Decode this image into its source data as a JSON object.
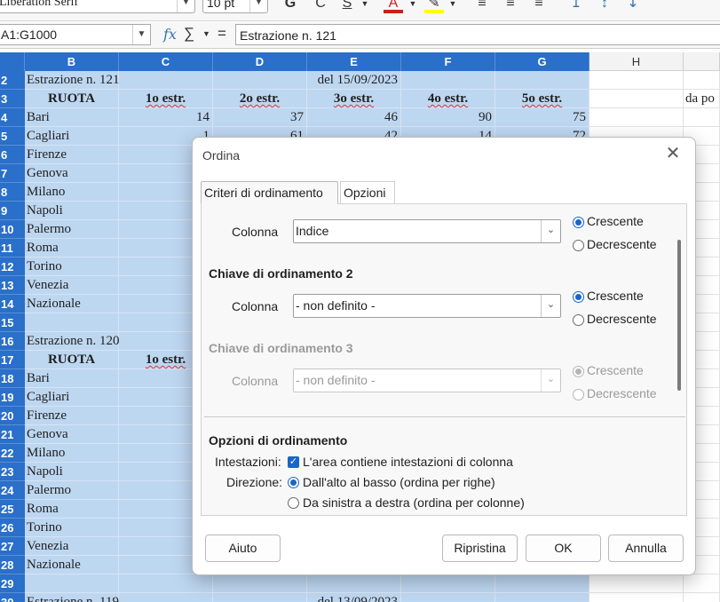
{
  "toolbar": {
    "font_name": "Liberation Serif",
    "font_size": "10 pt",
    "bold": "G",
    "italic": "C",
    "underline": "S",
    "font_color_letter": "A",
    "font_color": "#c9211e",
    "highlight_color": "#ffff00",
    "icons": [
      "bold-icon",
      "italic-icon",
      "underline-icon",
      "font-color-icon",
      "highlight-icon",
      "align-left-icon",
      "align-center-icon",
      "align-right-icon",
      "align-top-icon",
      "align-middle-icon",
      "align-bottom-icon"
    ]
  },
  "formula_bar": {
    "name_box": "A1:G1000",
    "content": "Estrazione n. 121"
  },
  "grid": {
    "columns": [
      "B",
      "C",
      "D",
      "E",
      "F",
      "G",
      "H"
    ],
    "rows": [
      {
        "n": "2",
        "cells": [
          "Estrazione n. 121",
          "",
          "",
          "del 15/09/2023",
          "",
          ""
        ]
      },
      {
        "n": "3",
        "cells": [
          "RUOTA",
          "1o estr.",
          "2o estr.",
          "3o estr.",
          "4o estr.",
          "5o estr."
        ],
        "h": "da po"
      },
      {
        "n": "4",
        "cells": [
          "Bari",
          "14",
          "37",
          "46",
          "90",
          "75"
        ]
      },
      {
        "n": "5",
        "cells": [
          "Cagliari",
          "1",
          "61",
          "42",
          "14",
          "72"
        ]
      },
      {
        "n": "6",
        "cells": [
          "Firenze"
        ]
      },
      {
        "n": "7",
        "cells": [
          "Genova"
        ]
      },
      {
        "n": "8",
        "cells": [
          "Milano"
        ]
      },
      {
        "n": "9",
        "cells": [
          "Napoli"
        ]
      },
      {
        "n": "10",
        "cells": [
          "Palermo"
        ]
      },
      {
        "n": "11",
        "cells": [
          "Roma"
        ]
      },
      {
        "n": "12",
        "cells": [
          "Torino"
        ]
      },
      {
        "n": "13",
        "cells": [
          "Venezia"
        ]
      },
      {
        "n": "14",
        "cells": [
          "Nazionale"
        ]
      },
      {
        "n": "15",
        "cells": [
          ""
        ]
      },
      {
        "n": "16",
        "cells": [
          "Estrazione n. 120"
        ]
      },
      {
        "n": "17",
        "cells": [
          "RUOTA",
          "1o estr."
        ]
      },
      {
        "n": "18",
        "cells": [
          "Bari"
        ]
      },
      {
        "n": "19",
        "cells": [
          "Cagliari"
        ]
      },
      {
        "n": "20",
        "cells": [
          "Firenze"
        ]
      },
      {
        "n": "21",
        "cells": [
          "Genova"
        ]
      },
      {
        "n": "22",
        "cells": [
          "Milano"
        ]
      },
      {
        "n": "23",
        "cells": [
          "Napoli"
        ]
      },
      {
        "n": "24",
        "cells": [
          "Palermo"
        ]
      },
      {
        "n": "25",
        "cells": [
          "Roma"
        ]
      },
      {
        "n": "26",
        "cells": [
          "Torino"
        ]
      },
      {
        "n": "27",
        "cells": [
          "Venezia"
        ]
      },
      {
        "n": "28",
        "cells": [
          "Nazionale"
        ]
      },
      {
        "n": "29",
        "cells": [
          ""
        ]
      },
      {
        "n": "30",
        "cells": [
          "Estrazione n. 119",
          "",
          "",
          "del 13/09/2023"
        ]
      }
    ]
  },
  "dialog": {
    "title": "Ordina",
    "tabs": [
      "Criteri di ordinamento",
      "Opzioni"
    ],
    "key1": {
      "column_label": "Colonna",
      "column_value": "Indice",
      "asc": "Crescente",
      "desc": "Decrescente"
    },
    "key2": {
      "heading": "Chiave di ordinamento 2",
      "column_label": "Colonna",
      "column_value": "- non definito -",
      "asc": "Crescente",
      "desc": "Decrescente"
    },
    "key3": {
      "heading": "Chiave di ordinamento 3",
      "column_label": "Colonna",
      "column_value": "- non definito -",
      "asc": "Crescente",
      "desc": "Decrescente"
    },
    "options": {
      "heading": "Opzioni di ordinamento",
      "headers_label": "Intestazioni:",
      "headers_value": "L'area contiene intestazioni di colonna",
      "direction_label": "Direzione:",
      "dir_top_bottom": "Dall'alto al basso (ordina per righe)",
      "dir_left_right": "Da sinistra a destra (ordina per colonne)"
    },
    "buttons": {
      "help": "Aiuto",
      "reset": "Ripristina",
      "ok": "OK",
      "cancel": "Annulla"
    }
  }
}
